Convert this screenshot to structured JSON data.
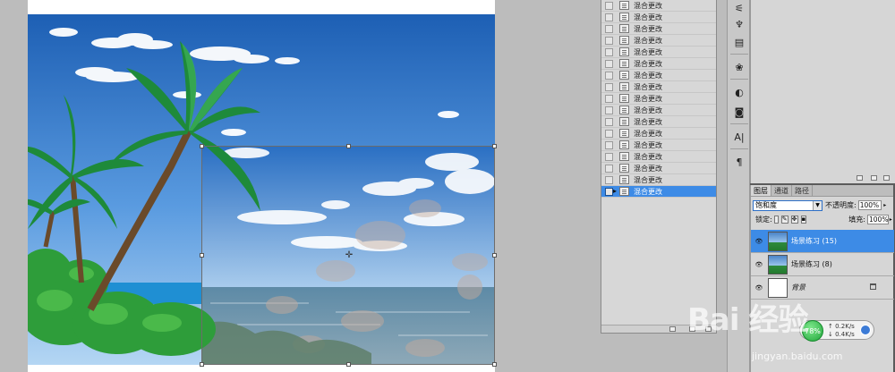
{
  "history": {
    "items": [
      {
        "label": "混合更改",
        "active": false
      },
      {
        "label": "混合更改",
        "active": false
      },
      {
        "label": "混合更改",
        "active": false
      },
      {
        "label": "混合更改",
        "active": false
      },
      {
        "label": "混合更改",
        "active": false
      },
      {
        "label": "混合更改",
        "active": false
      },
      {
        "label": "混合更改",
        "active": false
      },
      {
        "label": "混合更改",
        "active": false
      },
      {
        "label": "混合更改",
        "active": false
      },
      {
        "label": "混合更改",
        "active": false
      },
      {
        "label": "混合更改",
        "active": false
      },
      {
        "label": "混合更改",
        "active": false
      },
      {
        "label": "混合更改",
        "active": false
      },
      {
        "label": "混合更改",
        "active": false
      },
      {
        "label": "混合更改",
        "active": false
      },
      {
        "label": "混合更改",
        "active": false
      },
      {
        "label": "混合更改",
        "active": true
      }
    ]
  },
  "layers_panel": {
    "tabs": [
      "图层",
      "通道",
      "路径"
    ],
    "blend_mode": "饱和度",
    "opacity_label": "不透明度:",
    "opacity_value": "100%",
    "lock_label": "锁定:",
    "fill_label": "填充:",
    "fill_value": "100%",
    "layers": [
      {
        "name": "场景练习 (15)",
        "selected": true,
        "italic": false
      },
      {
        "name": "场景练习 (8)",
        "selected": false,
        "italic": false
      },
      {
        "name": "背景",
        "selected": false,
        "italic": true
      }
    ]
  },
  "speed_widget": {
    "percent": "78%",
    "up": "0.2K/s",
    "down": "0.4K/s"
  },
  "watermark": {
    "logo": "Bai 经验",
    "url": "jingyan.baidu.com"
  },
  "colors": {
    "selection": "#3d8be6",
    "sky_top": "#1d5fb4",
    "sky_bottom": "#a9cdf0",
    "sea": "#2f8fd0"
  }
}
